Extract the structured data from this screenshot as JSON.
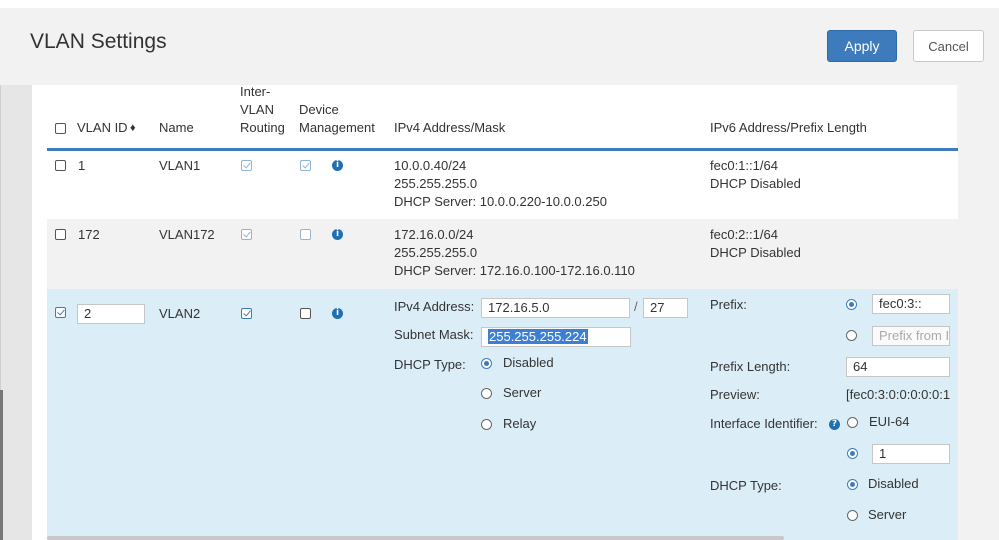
{
  "title": "VLAN Settings",
  "buttons": {
    "apply": "Apply",
    "cancel": "Cancel"
  },
  "table_header": {
    "vlan_id": "VLAN ID",
    "sort_icon": "sort-icon",
    "name": "Name",
    "inter_vlan_l1": "Inter-",
    "inter_vlan_l2": "VLAN",
    "inter_vlan_l3": "Routing",
    "device_l1": "Device",
    "device_l2": "Management",
    "ipv4": "IPv4 Address/Mask",
    "ipv6": "IPv6 Address/Prefix Length"
  },
  "rows": [
    {
      "id": "1",
      "name": "VLAN1",
      "inter_vlan": true,
      "device_mgmt": true,
      "selected": false,
      "ipv4_line1": "10.0.0.40/24",
      "ipv4_line2": "255.255.255.0",
      "ipv4_line3": "DHCP Server: 10.0.0.220-10.0.0.250",
      "ipv6_line1": "fec0:1::1/64",
      "ipv6_line2": "DHCP Disabled"
    },
    {
      "id": "172",
      "name": "VLAN172",
      "inter_vlan": true,
      "device_mgmt": false,
      "selected": false,
      "ipv4_line1": "172.16.0.0/24",
      "ipv4_line2": "255.255.255.0",
      "ipv4_line3": "DHCP Server: 172.16.0.100-172.16.0.110",
      "ipv6_line1": "fec0:2::1/64",
      "ipv6_line2": "DHCP Disabled"
    }
  ],
  "edit_row": {
    "id": "2",
    "name": "VLAN2",
    "inter_vlan": true,
    "device_mgmt": false,
    "selected": true,
    "ipv4": {
      "address_label": "IPv4 Address:",
      "address_value": "172.16.5.0",
      "slash": "/",
      "prefix_value": "27",
      "mask_label": "Subnet Mask:",
      "mask_value": "255.255.255.224",
      "dhcp_label": "DHCP Type:",
      "dhcp_options": [
        "Disabled",
        "Server",
        "Relay"
      ],
      "dhcp_selected": "Disabled"
    },
    "ipv6": {
      "prefix_label": "Prefix:",
      "prefix_value": "fec0:3::",
      "prefix_from_placeholder": "Prefix from I",
      "prefix_length_label": "Prefix Length:",
      "prefix_length_value": "64",
      "preview_label": "Preview:",
      "preview_value": "[fec0:3:0:0:0:0:0:1",
      "iface_id_label": "Interface Identifier:",
      "iface_option_eui": "EUI-64",
      "iface_value": "1",
      "dhcp_label": "DHCP Type:",
      "dhcp_options": [
        "Disabled",
        "Server"
      ],
      "dhcp_selected": "Disabled"
    }
  },
  "colors": {
    "accent": "#3e7bbd",
    "edit_row_bg": "#dbeef7",
    "alt_row_bg": "#f2f2f2",
    "selection": "#3d7fd2"
  }
}
